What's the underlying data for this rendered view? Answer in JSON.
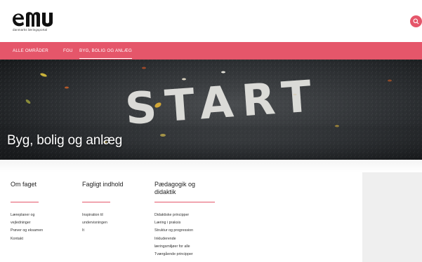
{
  "brand": {
    "logo_text": "emu",
    "tagline": "danmarks læringsportal",
    "accent": "#e5566a"
  },
  "header": {
    "search_icon": "search-icon"
  },
  "nav": {
    "items": [
      {
        "label": "ALLE OMRÅDER",
        "active": false
      },
      {
        "label": "FGU",
        "active": false
      },
      {
        "label": "BYG, BOLIG OG ANLÆG",
        "active": true
      }
    ]
  },
  "hero": {
    "title": "Byg, bolig og anlæg",
    "painted_text": "START"
  },
  "columns": [
    {
      "title": "Om faget",
      "links": [
        "Læreplaner og",
        "vejledninger",
        "Prøver og eksamen",
        "Kontakt"
      ]
    },
    {
      "title": "Fagligt indhold",
      "links": [
        "Inspiration til",
        "undervisningen",
        "It"
      ]
    },
    {
      "title": "Pædagogik og didaktik",
      "title_lines": [
        "Pædagogik og",
        "didaktik"
      ],
      "links": [
        "Didaktiske principper",
        "Læring i praksis",
        "Struktur og progression",
        "Inkluderende",
        "læringsmiljøer for alle",
        "Tværgående principper"
      ]
    }
  ]
}
